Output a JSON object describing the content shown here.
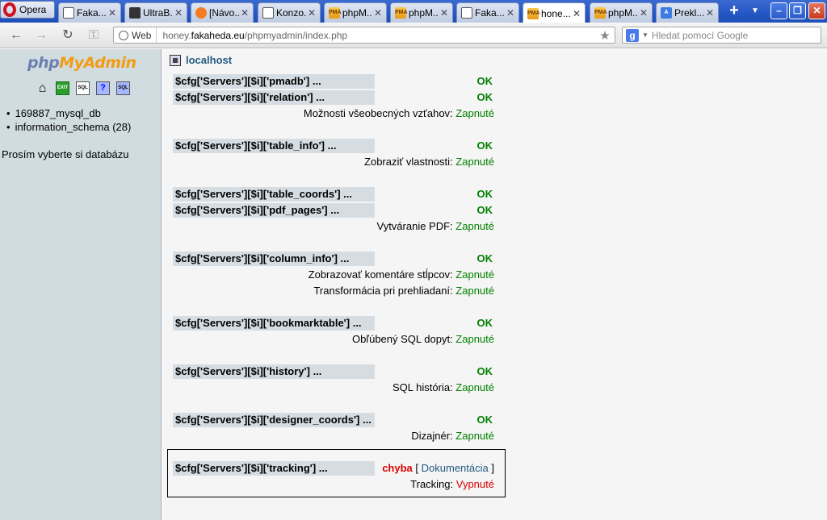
{
  "browser": {
    "menu_label": "Opera",
    "tabs": [
      {
        "label": "Faka...",
        "icon": "doc-favicon",
        "fav": "doc",
        "active": false
      },
      {
        "label": "UltraB...",
        "icon": "ultrabook-favicon",
        "fav": "ub",
        "active": false
      },
      {
        "label": "[Návo...",
        "icon": "forum-favicon",
        "fav": "nav",
        "active": false
      },
      {
        "label": "Konzo...",
        "icon": "doc-favicon",
        "fav": "doc",
        "active": false
      },
      {
        "label": "phpM...",
        "icon": "pma-favicon",
        "fav": "pma",
        "active": false
      },
      {
        "label": "phpM...",
        "icon": "pma-favicon",
        "fav": "pma",
        "active": false
      },
      {
        "label": "Faka...",
        "icon": "doc-favicon",
        "fav": "doc",
        "active": false
      },
      {
        "label": "hone...",
        "icon": "pma-favicon",
        "fav": "pma",
        "active": true
      },
      {
        "label": "phpM...",
        "icon": "pma-favicon",
        "fav": "pma",
        "active": false
      },
      {
        "label": "Prekl...",
        "icon": "translate-favicon",
        "fav": "tr",
        "active": false
      }
    ],
    "web_badge": "Web",
    "url_prefix": "honey.",
    "url_domain": "fakaheda.eu",
    "url_path": "/phpmyadmin/index.php",
    "search_placeholder": "Hledat pomocí Google"
  },
  "sidebar": {
    "logo_php": "php",
    "logo_myadmin": "MyAdmin",
    "databases": [
      "169887_mysql_db",
      "information_schema (28)"
    ],
    "prompt": "Prosím vyberte si databázu"
  },
  "main": {
    "server": "localhost",
    "checks": [
      {
        "name": "$cfg['Servers'][$i]['pmadb'] ...",
        "status": "OK"
      },
      {
        "name": "$cfg['Servers'][$i]['relation'] ...",
        "status": "OK"
      },
      {
        "name": "$cfg['Servers'][$i]['table_info'] ...",
        "status": "OK"
      },
      {
        "name": "$cfg['Servers'][$i]['table_coords'] ...",
        "status": "OK"
      },
      {
        "name": "$cfg['Servers'][$i]['pdf_pages'] ...",
        "status": "OK"
      },
      {
        "name": "$cfg['Servers'][$i]['column_info'] ...",
        "status": "OK"
      },
      {
        "name": "$cfg['Servers'][$i]['bookmarktable'] ...",
        "status": "OK"
      },
      {
        "name": "$cfg['Servers'][$i]['history'] ...",
        "status": "OK"
      },
      {
        "name": "$cfg['Servers'][$i]['designer_coords'] ...",
        "status": "OK"
      },
      {
        "name": "$cfg['Servers'][$i]['tracking'] ...",
        "status": "chyba"
      }
    ],
    "features": [
      {
        "label": "Možnosti všeobecných vzťahov:",
        "value": "Zapnuté"
      },
      {
        "label": "Zobraziť vlastnosti:",
        "value": "Zapnuté"
      },
      {
        "label": "Vytváranie PDF:",
        "value": "Zapnuté"
      },
      {
        "label": "Zobrazovať komentáre stĺpcov:",
        "value": "Zapnuté"
      },
      {
        "label": "Transformácia pri prehliadaní:",
        "value": "Zapnuté"
      },
      {
        "label": "Obľúbený SQL dopyt:",
        "value": "Zapnuté"
      },
      {
        "label": "SQL história:",
        "value": "Zapnuté"
      },
      {
        "label": "Dizajnér:",
        "value": "Zapnuté"
      },
      {
        "label": "Tracking:",
        "value": "Vypnuté"
      }
    ],
    "doc_bracket_open": "[",
    "doc_link": "Dokumentácia",
    "doc_bracket_close": "]"
  },
  "colors": {
    "ok": "#008000",
    "error": "#dd0000",
    "link": "#235a81",
    "sidebar_bg": "#d0dce0",
    "cfg_row_bg": "#d5dde2"
  }
}
